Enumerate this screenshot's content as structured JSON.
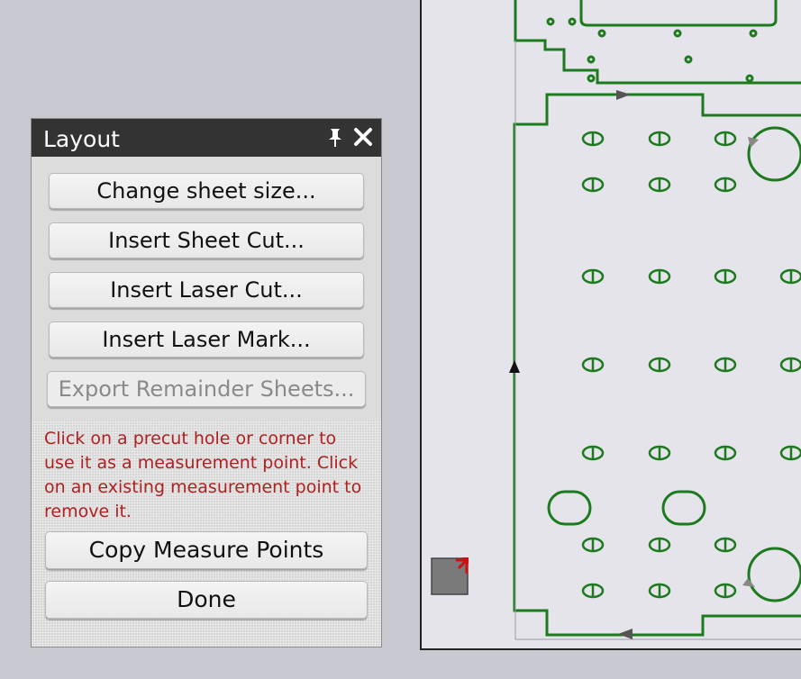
{
  "panel": {
    "title": "Layout",
    "buttons": [
      {
        "label": "Change sheet size..."
      },
      {
        "label": "Insert Sheet Cut..."
      },
      {
        "label": "Insert Laser Cut..."
      },
      {
        "label": "Insert Laser Mark..."
      },
      {
        "label": "Export Remainder Sheets..."
      }
    ],
    "instructions": "Click on a precut hole or corner to use it as a measurement point. Click on an existing measurement point to remove it.",
    "copy_button": "Copy Measure Points",
    "done_button": "Done"
  },
  "colors": {
    "cut_path": "#1e7a1e",
    "instruction_text": "#b02020",
    "header_bg": "#333333"
  },
  "icons": [
    "pin-icon",
    "close-icon",
    "measure-point-icon",
    "direction-arrow-icon"
  ]
}
